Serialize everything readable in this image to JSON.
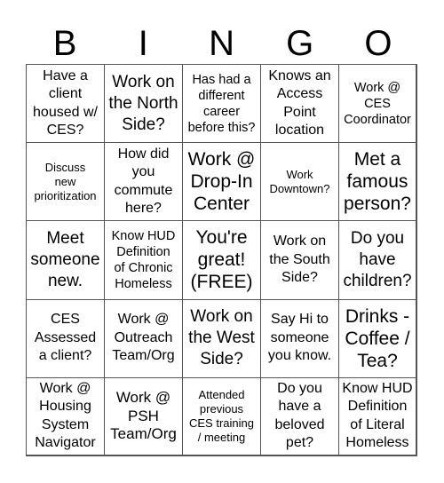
{
  "header": {
    "letters": [
      "B",
      "I",
      "N",
      "G",
      "O"
    ]
  },
  "cells": [
    {
      "text": "Have a\nclient\nhoused w/\nCES?",
      "free": false
    },
    {
      "text": "Work on\nthe North\nSide?",
      "free": false
    },
    {
      "text": "Has had a\ndifferent\ncareer\nbefore this?",
      "free": false
    },
    {
      "text": "Knows an\nAccess\nPoint\nlocation",
      "free": false
    },
    {
      "text": "Work @\nCES\nCoordinator",
      "free": false
    },
    {
      "text": "Discuss\nnew\nprioritization",
      "free": false
    },
    {
      "text": "How did\nyou\ncommute\nhere?",
      "free": false
    },
    {
      "text": "Work @\nDrop-In\nCenter",
      "free": false
    },
    {
      "text": "Work\nDowntown?",
      "free": false
    },
    {
      "text": "Met a\nfamous\nperson?",
      "free": false
    },
    {
      "text": "Meet\nsomeone\nnew.",
      "free": false
    },
    {
      "text": "Know HUD\nDefinition\nof Chronic\nHomeless",
      "free": false
    },
    {
      "text": "You're\ngreat!\n(FREE)",
      "free": true
    },
    {
      "text": "Work on\nthe South\nSide?",
      "free": false
    },
    {
      "text": "Do you\nhave\nchildren?",
      "free": false
    },
    {
      "text": "CES\nAssessed\na client?",
      "free": false
    },
    {
      "text": "Work @\nOutreach\nTeam/Org",
      "free": false
    },
    {
      "text": "Work on\nthe West\nSide?",
      "free": false
    },
    {
      "text": "Say Hi to\nsomeone\nyou know.",
      "free": false
    },
    {
      "text": "Drinks -\nCoffee /\nTea?",
      "free": false
    },
    {
      "text": "Work @\nHousing\nSystem\nNavigator",
      "free": false
    },
    {
      "text": "Work @\nPSH\nTeam/Org",
      "free": false
    },
    {
      "text": "Attended\nprevious\nCES training\n/ meeting",
      "free": false
    },
    {
      "text": "Do you\nhave a\nbeloved\npet?",
      "free": false
    },
    {
      "text": "Know HUD\nDefinition\nof Literal\nHomeless",
      "free": false
    }
  ]
}
